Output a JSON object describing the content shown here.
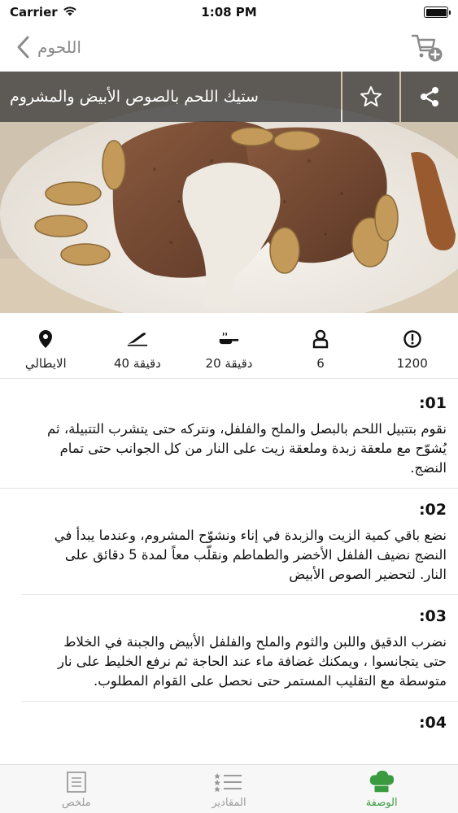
{
  "status_bar": {
    "carrier": "Carrier",
    "time": "1:08 PM"
  },
  "nav": {
    "back_label": "اللحوم"
  },
  "recipe": {
    "title": "ستيك اللحم بالصوص الأبيض والمشروم"
  },
  "info": [
    {
      "icon": "location-pin-icon",
      "value": "الايطالي"
    },
    {
      "icon": "knife-icon",
      "value": "40 دقيقة"
    },
    {
      "icon": "frying-pan-icon",
      "value": "20 دقيقة"
    },
    {
      "icon": "chef-hat-icon",
      "value": "6"
    },
    {
      "icon": "calories-icon",
      "value": "1200"
    }
  ],
  "steps": [
    {
      "number": ":01",
      "text": "نقوم بتتبيل اللحم بالبصل والملح والفلفل، ونتركه حتى يتشرب التتبيلة، ثم يُشوّح مع ملعقة زبدة وملعقة زيت على النار من كل الجوانب حتى تمام النضج."
    },
    {
      "number": ":02",
      "text": "نضع باقي كمية الزيت والزبدة في إناء ونشوّح المشروم، وعندما يبدأ في النضج نضيف الفلفل الأخضر والطماطم ونقلّب معاً لمدة 5 دقائق على النار. لتحضير الصوص الأبيض"
    },
    {
      "number": ":03",
      "text": "نضرب الدقيق واللبن والثوم والملح والفلفل الأبيض والجبنة في الخلاط حتى يتجانسوا ، ويمكنك غضافة ماء عند الحاجة ثم نرفع الخليط على نار متوسطة مع التقليب المستمر حتى نحصل على القوام المطلوب."
    },
    {
      "number": ":04",
      "text": ""
    }
  ],
  "tabs": [
    {
      "label": "ملخص",
      "icon": "notes-icon",
      "active": false
    },
    {
      "label": "المقادير",
      "icon": "ingredients-list-icon",
      "active": false
    },
    {
      "label": "الوصفة",
      "icon": "chef-hat-icon",
      "active": true
    }
  ],
  "colors": {
    "accent": "#3a9a3f",
    "nav_gray": "#8a8a8a",
    "overlay": "#3c3c3c"
  }
}
